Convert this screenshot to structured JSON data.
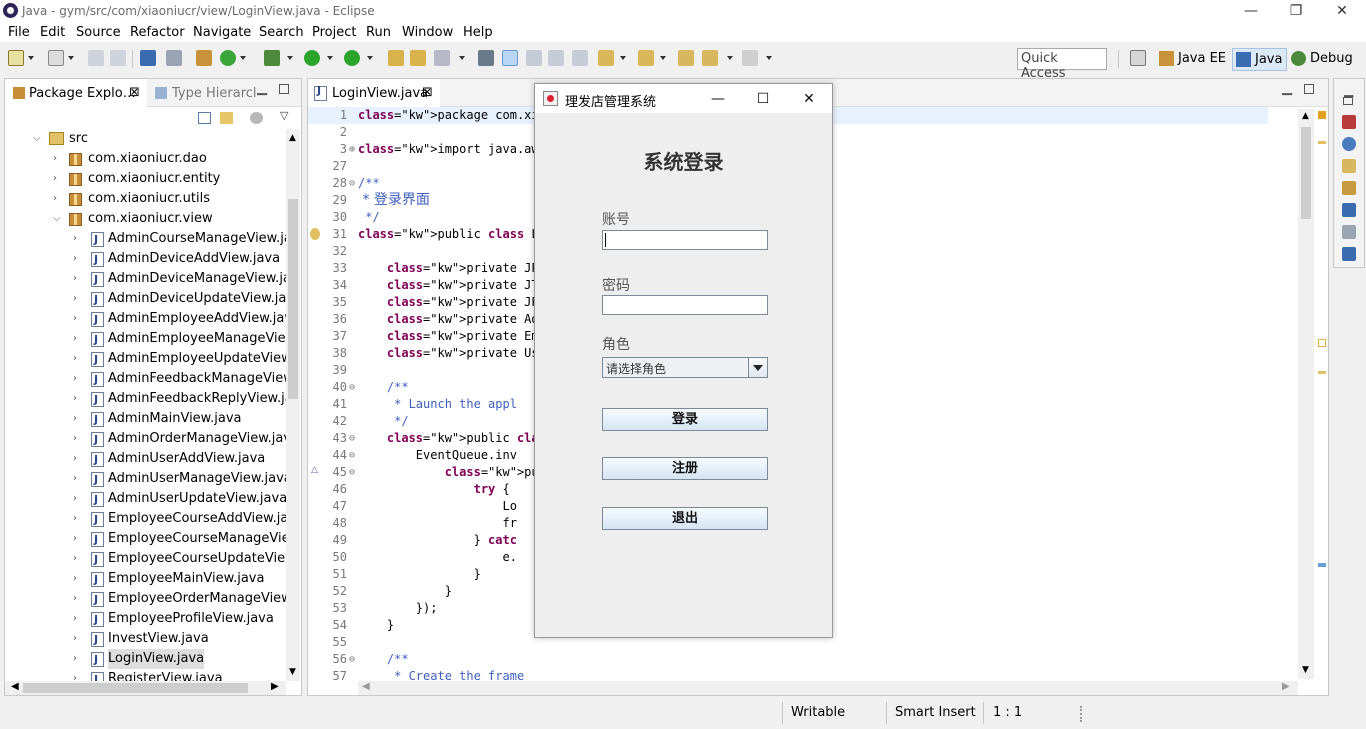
{
  "window": {
    "title": "Java - gym/src/com/xiaoniucr/view/LoginView.java - Eclipse",
    "minimize": "—",
    "restore": "❐",
    "close": "✕"
  },
  "menu": [
    "File",
    "Edit",
    "Source",
    "Refactor",
    "Navigate",
    "Search",
    "Project",
    "Run",
    "Window",
    "Help"
  ],
  "toolbar": {
    "quick_access": "Quick Access",
    "perspectives": [
      "Java EE",
      "Java",
      "Debug"
    ]
  },
  "explorer": {
    "tabs": [
      "Package Explo…",
      "Type Hierarcl"
    ],
    "src_label": "src",
    "packages": [
      "com.xiaoniucr.dao",
      "com.xiaoniucr.entity",
      "com.xiaoniucr.utils",
      "com.xiaoniucr.view"
    ],
    "files": [
      "AdminCourseManageView.java",
      "AdminDeviceAddView.java",
      "AdminDeviceManageView.java",
      "AdminDeviceUpdateView.java",
      "AdminEmployeeAddView.java",
      "AdminEmployeeManageView.ja",
      "AdminEmployeeUpdateView.ja",
      "AdminFeedbackManageView.ja",
      "AdminFeedbackReplyView.java",
      "AdminMainView.java",
      "AdminOrderManageView.java",
      "AdminUserAddView.java",
      "AdminUserManageView.java",
      "AdminUserUpdateView.java",
      "EmployeeCourseAddView.java",
      "EmployeeCourseManageView.",
      "EmployeeCourseUpdateView.ja",
      "EmployeeMainView.java",
      "EmployeeOrderManageView.ja",
      "EmployeeProfileView.java",
      "InvestView.java",
      "LoginView.java",
      "RegisterView.java"
    ]
  },
  "editor": {
    "tab": "LoginView.java",
    "lines": [
      {
        "n": "1",
        "f": "",
        "t": "package com.xiaoniucr."
      },
      {
        "n": "2",
        "f": "",
        "t": ""
      },
      {
        "n": "3",
        "f": "⊕",
        "t": "import java.awt.EventQ"
      },
      {
        "n": "27",
        "f": "",
        "t": ""
      },
      {
        "n": "28",
        "f": "⊖",
        "t": "/**"
      },
      {
        "n": "29",
        "f": "",
        "t": " * 登录界面"
      },
      {
        "n": "30",
        "f": "",
        "t": " */"
      },
      {
        "n": "31",
        "f": "",
        "t": "public class LoginView"
      },
      {
        "n": "32",
        "f": "",
        "t": ""
      },
      {
        "n": "33",
        "f": "",
        "t": "    private JPanel con"
      },
      {
        "n": "34",
        "f": "",
        "t": "    private JTextField"
      },
      {
        "n": "35",
        "f": "",
        "t": "    private JPasswordF"
      },
      {
        "n": "36",
        "f": "",
        "t": "    private AdminDao a"
      },
      {
        "n": "37",
        "f": "",
        "t": "    private EmployeeDa"
      },
      {
        "n": "38",
        "f": "",
        "t": "    private UserDao us"
      },
      {
        "n": "39",
        "f": "",
        "t": ""
      },
      {
        "n": "40",
        "f": "⊖",
        "t": "    /**"
      },
      {
        "n": "41",
        "f": "",
        "t": "     * Launch the appl"
      },
      {
        "n": "42",
        "f": "",
        "t": "     */"
      },
      {
        "n": "43",
        "f": "⊖",
        "t": "    public static void"
      },
      {
        "n": "44",
        "f": "⊖",
        "t": "        EventQueue.inv"
      },
      {
        "n": "45",
        "f": "⊖",
        "t": "            public voi"
      },
      {
        "n": "46",
        "f": "",
        "t": "                try {"
      },
      {
        "n": "47",
        "f": "",
        "t": "                    Lo"
      },
      {
        "n": "48",
        "f": "",
        "t": "                    fr"
      },
      {
        "n": "49",
        "f": "",
        "t": "                } catc"
      },
      {
        "n": "50",
        "f": "",
        "t": "                    e."
      },
      {
        "n": "51",
        "f": "",
        "t": "                }"
      },
      {
        "n": "52",
        "f": "",
        "t": "            }"
      },
      {
        "n": "53",
        "f": "",
        "t": "        });"
      },
      {
        "n": "54",
        "f": "",
        "t": "    }"
      },
      {
        "n": "55",
        "f": "",
        "t": ""
      },
      {
        "n": "56",
        "f": "⊖",
        "t": "    /**"
      },
      {
        "n": "57",
        "f": "",
        "t": "     * Create the frame"
      }
    ]
  },
  "status": {
    "writable": "Writable",
    "insert_mode": "Smart Insert",
    "position": "1 : 1"
  },
  "dialog": {
    "title": "理发店管理系统",
    "heading": "系统登录",
    "account_label": "账号",
    "password_label": "密码",
    "role_label": "角色",
    "role_value": "请选择角色",
    "login": "登录",
    "register": "注册",
    "exit": "退出",
    "minimize": "—",
    "maximize": "☐",
    "close": "✕"
  }
}
